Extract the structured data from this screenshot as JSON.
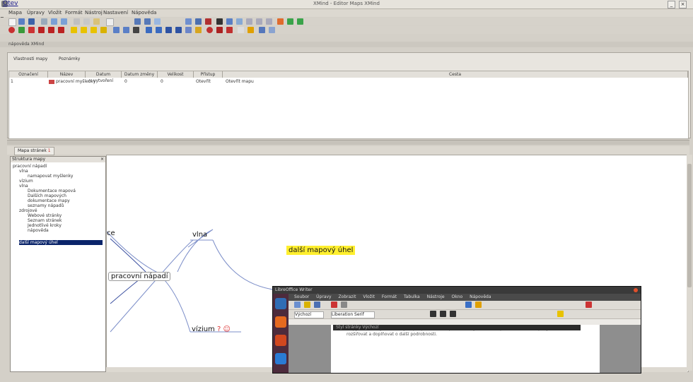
{
  "window": {
    "title": "XMind - Editor Maps XMind",
    "minimize": "_",
    "close": "×"
  },
  "overlay": {
    "link_text": "Otev",
    "side_letter": "a"
  },
  "menu": [
    "Mapa",
    "Úpravy",
    "Vložit",
    "Formát",
    "Nástroj",
    "Nastavení",
    "Nápověda"
  ],
  "toolwindow_label": "nápověda XMind",
  "panel": {
    "tabs": [
      "Vlastnosti mapy",
      "Poznámky"
    ],
    "columns": [
      "Označení",
      "Název",
      "Datum vytvoření",
      "Datum změny",
      "Velikost",
      "Přístup",
      "Cesta"
    ],
    "rows": [
      {
        "id": "1",
        "name": "pracovní myšlenky",
        "created": "0",
        "modified": "0",
        "size": "0",
        "access": "Otevřít",
        "path": "Otevřít mapu"
      }
    ]
  },
  "map_tab": {
    "label": "Mapa stránek",
    "count": "1"
  },
  "tree": {
    "header": "Struktura mapy",
    "close": "×",
    "nodes": [
      {
        "text": "pracovní nápadí",
        "indent": 0
      },
      {
        "text": "vlna",
        "indent": 1
      },
      {
        "text": "namapovat myšlenky",
        "indent": 2
      },
      {
        "text": "vízium",
        "indent": 1
      },
      {
        "text": "vlna",
        "indent": 1
      },
      {
        "text": "Dokumentace mapová",
        "indent": 2
      },
      {
        "text": "Dalších mapových",
        "indent": 2
      },
      {
        "text": "dokumentace mapy",
        "indent": 2
      },
      {
        "text": "seznamy nápadů",
        "indent": 2
      },
      {
        "text": "zdrojové",
        "indent": 1
      },
      {
        "text": "Webové stránky",
        "indent": 2
      },
      {
        "text": "Seznam stránek",
        "indent": 2
      },
      {
        "text": "Jednotlivé kroky",
        "indent": 2
      },
      {
        "text": "nápověda",
        "indent": 2
      },
      {
        "text": "další mapový úhel",
        "indent": 1,
        "selected": true
      }
    ]
  },
  "map": {
    "left_partial": "ce",
    "vlna": "vlna",
    "center": "pracovní nápadí",
    "highlight": "další mapový úhel",
    "vizium": "vízium",
    "vizium_icons": "? ☺"
  },
  "inset": {
    "title": "LibreOffice Writer",
    "menu": [
      "Soubor",
      "Úpravy",
      "Zobrazit",
      "Vložit",
      "Formát",
      "Tabulka",
      "Nástroje",
      "Okno",
      "Nápověda"
    ],
    "style_box": "Výchozí",
    "font_box": "Liberation Serif",
    "doc_text": "Mapy ve XMind jsou nástrojem pro přehledné uspořádání myšlenek a nápadů. Pracovní nápady můžete rozšiřovat a doplňovat o další podrobnosti.",
    "docbar_text": "Styl stránky  Výchozí"
  },
  "colors": {
    "accent": "#0a246a",
    "highlight": "#ffef2e",
    "launcher": "#4d2b3c"
  }
}
